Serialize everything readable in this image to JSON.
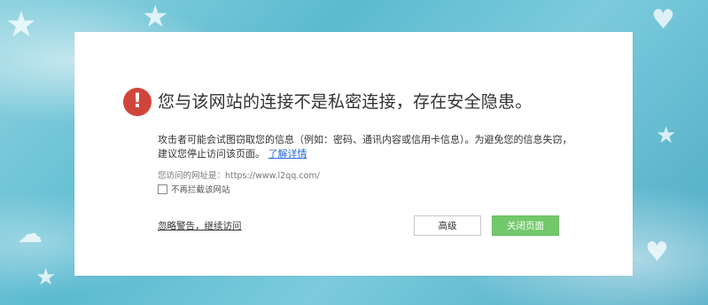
{
  "warning": {
    "title": "您与该网站的连接不是私密连接，存在安全隐患。",
    "description": "攻击者可能会试图窃取您的信息（例如：密码、通讯内容或信用卡信息）。为避免您的信息失窃，建议您停止访问该页面。",
    "learn_more": "了解详情",
    "url_label": "您访问的网址是：",
    "url": "https://www.l2qq.com/",
    "dont_block_label": "不再拦截该网站",
    "ignore_link": "忽略警告，继续访问",
    "advanced_button": "高级",
    "close_button": "关闭页面"
  },
  "colors": {
    "warning_icon": "#d0453b",
    "close_button": "#72c86a",
    "link": "#2a6ad8"
  },
  "icons": {
    "warning": "exclamation-circle-icon",
    "checkbox": "checkbox-unchecked"
  }
}
